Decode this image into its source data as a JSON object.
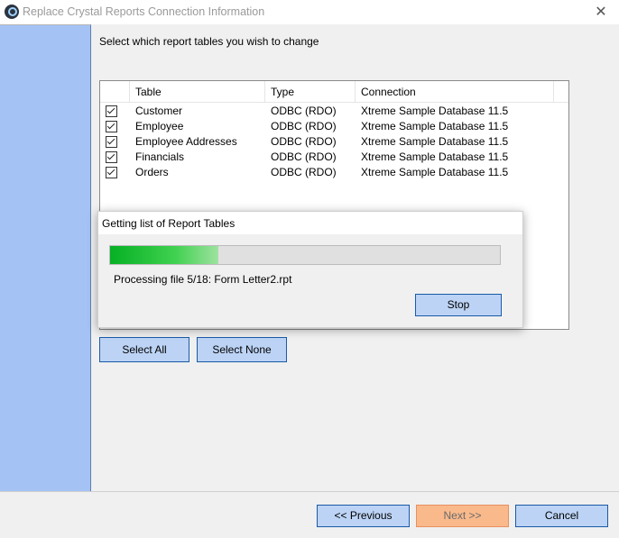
{
  "window": {
    "title": "Replace Crystal Reports Connection Information",
    "close_glyph": "✕"
  },
  "main": {
    "instruction": "Select which report tables you wish to change",
    "table_headers": [
      "Table",
      "Type",
      "Connection"
    ],
    "tables": [
      {
        "checked": true,
        "table": "Customer",
        "type": "ODBC (RDO)",
        "connection": "Xtreme Sample Database 11.5"
      },
      {
        "checked": true,
        "table": "Employee",
        "type": "ODBC (RDO)",
        "connection": "Xtreme Sample Database 11.5"
      },
      {
        "checked": true,
        "table": "Employee Addresses",
        "type": "ODBC (RDO)",
        "connection": "Xtreme Sample Database 11.5"
      },
      {
        "checked": true,
        "table": "Financials",
        "type": "ODBC (RDO)",
        "connection": "Xtreme Sample Database 11.5"
      },
      {
        "checked": true,
        "table": "Orders",
        "type": "ODBC (RDO)",
        "connection": "Xtreme Sample Database 11.5"
      }
    ],
    "select_all_label": "Select All",
    "select_none_label": "Select None"
  },
  "progress_dialog": {
    "title": "Getting list of Report Tables",
    "progress_fraction": 0.277,
    "status": "Processing file 5/18: Form Letter2.rpt",
    "stop_label": "Stop"
  },
  "footer": {
    "previous_label": "<< Previous",
    "next_label": "Next >>",
    "cancel_label": "Cancel"
  },
  "colors": {
    "sidebar": "#a4c2f4",
    "button": "#bcd3f5",
    "button_border": "#1a5aa8",
    "next_disabled": "#f9b98b",
    "progress": "#06b025"
  },
  "icons": {
    "app": "crystal-reports-icon",
    "close": "close-icon",
    "check": "checkbox-checked-icon"
  }
}
